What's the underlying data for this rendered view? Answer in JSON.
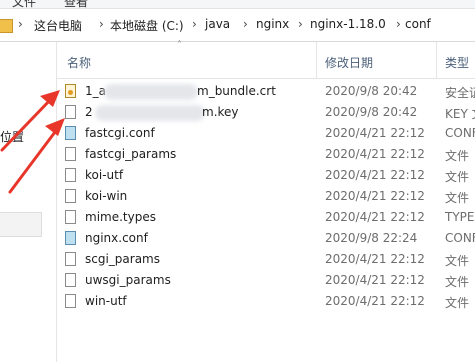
{
  "ribbon": {
    "item1": "文件",
    "item2": "查看"
  },
  "breadcrumb": [
    "这台电脑",
    "本地磁盘 (C:)",
    "java",
    "nginx",
    "nginx-1.18.0",
    "conf"
  ],
  "nav": {
    "location_label": "位置"
  },
  "columns": {
    "name": "名称",
    "modified": "修改日期",
    "type": "类型"
  },
  "files": [
    {
      "name": "1_a",
      "name_tail": "m_bundle.crt",
      "date": "2020/9/8 20:42",
      "type": "安全证",
      "icon": "certificate-icon"
    },
    {
      "name": "2",
      "name_tail": "m.key",
      "date": "2020/9/8 20:42",
      "type": "KEY 文",
      "icon": "file-icon"
    },
    {
      "name": "fastcgi.conf",
      "date": "2020/4/21 22:12",
      "type": "CONF",
      "icon": "conf-file-icon"
    },
    {
      "name": "fastcgi_params",
      "date": "2020/4/21 22:12",
      "type": "文件",
      "icon": "file-icon"
    },
    {
      "name": "koi-utf",
      "date": "2020/4/21 22:12",
      "type": "文件",
      "icon": "file-icon"
    },
    {
      "name": "koi-win",
      "date": "2020/4/21 22:12",
      "type": "文件",
      "icon": "file-icon"
    },
    {
      "name": "mime.types",
      "date": "2020/4/21 22:12",
      "type": "TYPES",
      "icon": "file-icon"
    },
    {
      "name": "nginx.conf",
      "date": "2020/9/8 22:24",
      "type": "CONF",
      "icon": "conf-file-icon"
    },
    {
      "name": "scgi_params",
      "date": "2020/4/21 22:12",
      "type": "文件",
      "icon": "file-icon"
    },
    {
      "name": "uwsgi_params",
      "date": "2020/4/21 22:12",
      "type": "文件",
      "icon": "file-icon"
    },
    {
      "name": "win-utf",
      "date": "2020/4/21 22:12",
      "type": "文件",
      "icon": "file-icon"
    }
  ],
  "colors": {
    "annotation_arrow": "#e8362a",
    "header_text": "#4c607a"
  }
}
